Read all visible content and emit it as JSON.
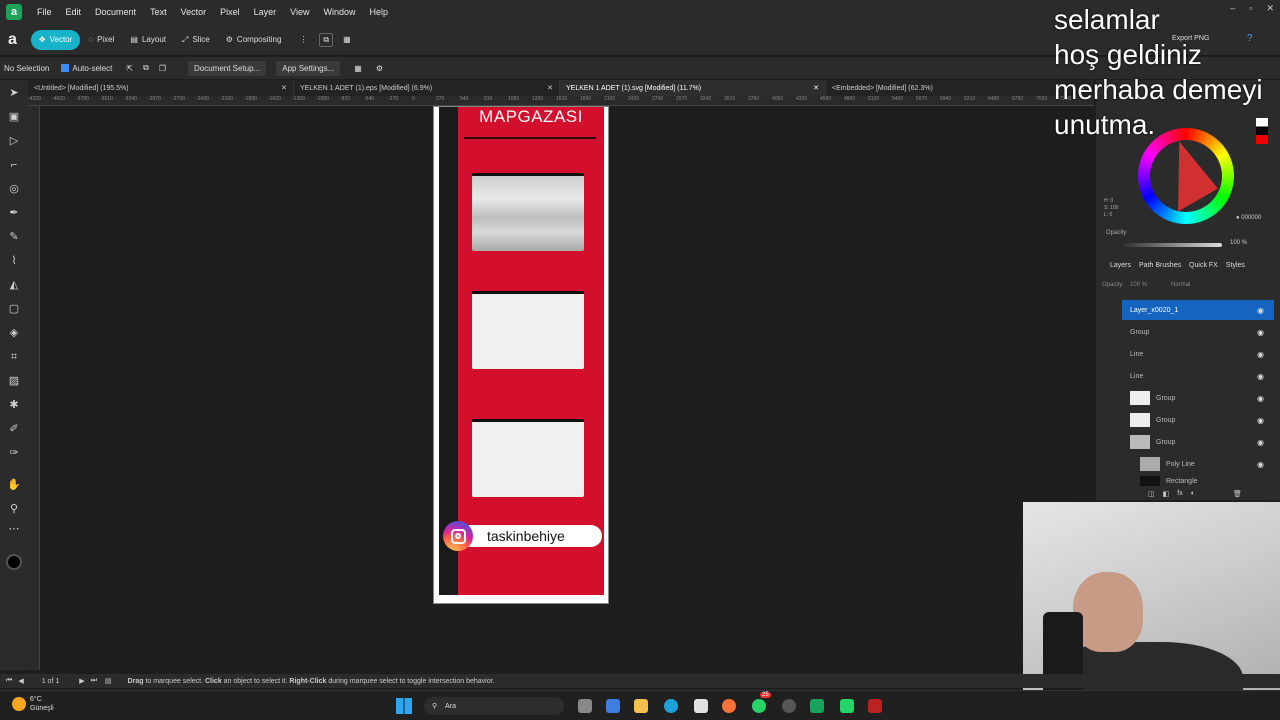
{
  "menubar": {
    "items": [
      "File",
      "Edit",
      "Document",
      "Text",
      "Vector",
      "Pixel",
      "Layer",
      "View",
      "Window",
      "Help"
    ]
  },
  "toolbar": {
    "personas": [
      "Vector",
      "Pixel",
      "Layout",
      "Slice",
      "Compositing"
    ],
    "export_label": "Export PNG"
  },
  "contextbar": {
    "selection": "No Selection",
    "auto_select": "Auto-select",
    "document_setup": "Document Setup...",
    "app_settings": "App Settings..."
  },
  "tabs": [
    {
      "label": "<Untitled> [Modified] (195.5%)"
    },
    {
      "label": "YELKEN 1 ADET (1).eps [Modified] (6.9%)"
    },
    {
      "label": "YELKEN 1 ADET (1).svg [Modified] (11.7%)"
    },
    {
      "label": "<Embedded> [Modified] (62.3%)"
    }
  ],
  "ruler": {
    "ticks": [
      "-4320",
      "-4020",
      "-3780",
      "-3510",
      "-3240",
      "-2970",
      "-2700",
      "-2430",
      "-2160",
      "-1890",
      "-1620",
      "-1350",
      "-1080",
      "-810",
      "-540",
      "-270",
      "0",
      "270",
      "540",
      "810",
      "1080",
      "1350",
      "1620",
      "1890",
      "2160",
      "2430",
      "2700",
      "2970",
      "3240",
      "3510",
      "3780",
      "4050",
      "4320",
      "4590",
      "4860",
      "5130",
      "5400",
      "5670",
      "5940",
      "6210",
      "6480",
      "6750",
      "7020",
      "7290"
    ]
  },
  "document": {
    "title": "MAPGAZASI",
    "instagram_handle": "taskinbehiye"
  },
  "colorpanel": {
    "h": "H: 0",
    "s": "S: 100",
    "l": "L: 0",
    "hex": "000000",
    "opacity_label": "Opacity",
    "opacity_value": "100 %"
  },
  "layers": {
    "tabs": [
      "Layers",
      "Path Brushes",
      "Quick FX",
      "Styles"
    ],
    "opacity": "100 %",
    "blend": "Normal",
    "rows": [
      {
        "name": "Layer_x0020_1"
      },
      {
        "name": "Group"
      },
      {
        "name": "Line"
      },
      {
        "name": "Line"
      },
      {
        "name": "Group"
      },
      {
        "name": "Group"
      },
      {
        "name": "Group"
      },
      {
        "name": "Poly Line"
      },
      {
        "name": "Rectangle"
      }
    ]
  },
  "overlay": {
    "line1": "selamlar",
    "line2": "hoş geldiniz",
    "line3": "merhaba demeyi",
    "line4": "unutma."
  },
  "statusbar": {
    "page": "1 of 1",
    "hint_drag": "Drag",
    "hint_1": " to marquee select. ",
    "hint_click": "Click",
    "hint_2": " an object to select it. ",
    "hint_right": "Right-Click",
    "hint_3": " during marquee select to toggle intersection behavior."
  },
  "taskbar": {
    "weather_temp": "6°C",
    "weather_desc": "Güneşli",
    "search": "Ara",
    "badge": "25"
  }
}
